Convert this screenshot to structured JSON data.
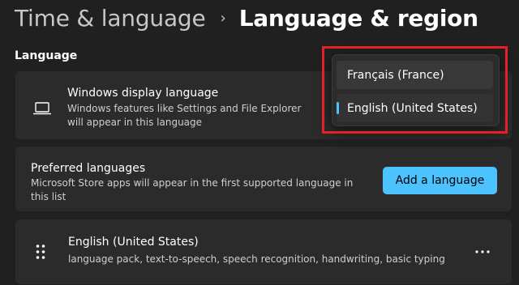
{
  "header": {
    "parent": "Time & language",
    "separator": "›",
    "current": "Language & region"
  },
  "language_section": {
    "label": "Language"
  },
  "display_language": {
    "icon": "laptop-icon",
    "title": "Windows display language",
    "description": "Windows features like Settings and File Explorer will appear in this language"
  },
  "dropdown": {
    "options": [
      {
        "label": "Français (France)",
        "selected": false
      },
      {
        "label": "English (United States)",
        "selected": true
      }
    ],
    "accent": "#4cc2ff",
    "highlight_color": "#e5202a"
  },
  "preferred_languages": {
    "title": "Preferred languages",
    "description": "Microsoft Store apps will appear in the first supported language in this list",
    "add_button": "Add a language"
  },
  "installed_language": {
    "title": "English (United States)",
    "description": "language pack, text-to-speech, speech recognition, handwriting, basic typing",
    "drag_icon": "drag-handle-icon",
    "more_icon": "more-options-icon"
  }
}
